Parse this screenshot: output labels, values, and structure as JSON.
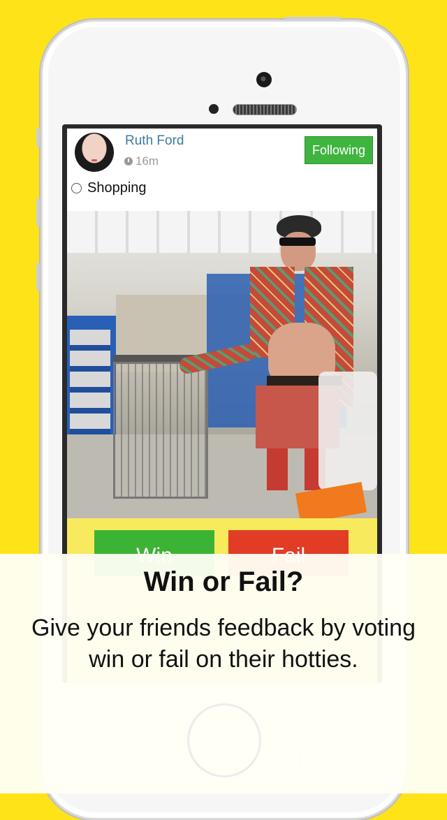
{
  "post": {
    "user_name": "Ruth Ford",
    "time_ago": "16m",
    "follow_label": "Following",
    "title": "Shopping"
  },
  "vote": {
    "win_label": "Win",
    "fail_label": "Fail"
  },
  "promo": {
    "headline": "Win or Fail?",
    "subline": "Give your friends feedback by voting win or fail on their hotties."
  },
  "colors": {
    "background": "#FFE319",
    "accent_green": "#3fb540",
    "fail_red": "#e03c26",
    "vote_bar": "#f8ea5d",
    "user_name_blue": "#3d7aa6"
  },
  "icons": [
    "clock-icon",
    "chat-bubble-icon",
    "camera-icon",
    "speaker-icon",
    "home-button"
  ]
}
